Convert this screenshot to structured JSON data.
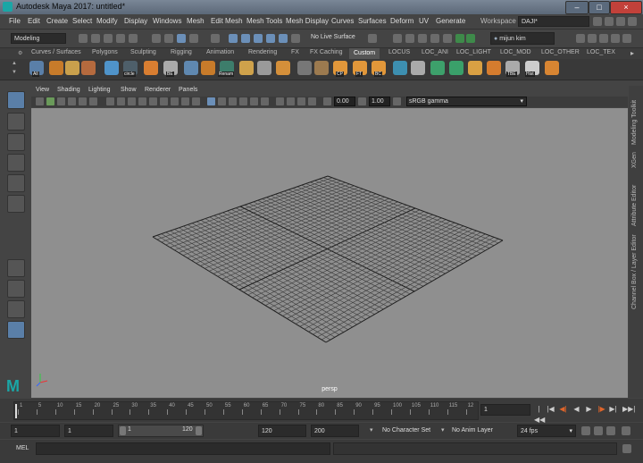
{
  "window": {
    "title": "Autodesk Maya 2017: untitled*",
    "minimize": "–",
    "maximize": "□",
    "close": "×"
  },
  "menubar": {
    "items": [
      "File",
      "Edit",
      "Create",
      "Select",
      "Modify",
      "Display",
      "Windows",
      "Mesh",
      "Edit Mesh",
      "Mesh Tools",
      "Mesh Display",
      "Curves",
      "Surfaces",
      "Deform",
      "UV",
      "Generate"
    ],
    "workspace_label": "Workspace :",
    "workspace_value": "DAJI*"
  },
  "statusline": {
    "mode": "Modeling",
    "live_surface": "No Live Surface",
    "user": "mijun kim"
  },
  "shelf": {
    "tabs": [
      "Curves / Surfaces",
      "Polygons",
      "Sculpting",
      "Rigging",
      "Animation",
      "Rendering",
      "FX",
      "FX Caching",
      "Custom",
      "LOCUS",
      "LOC_ANI",
      "LOC_LIGHT",
      "LOC_MOD",
      "LOC_OTHER",
      "LOC_TEX"
    ],
    "active_tab": "Custom",
    "icon_labels": {
      "all": "All",
      "circle": "circle",
      "be": "BE",
      "rename": "Renam",
      "cp": "CP",
      "ft": "FT",
      "bc": "BC",
      "tbe": "TBE",
      "hist": "Hist"
    }
  },
  "panel": {
    "menu": [
      "View",
      "Shading",
      "Lighting",
      "Show",
      "Renderer",
      "Panels"
    ],
    "exposure": "0.00",
    "gamma": "1.00",
    "colorspace": "sRGB gamma",
    "camera_label": "persp",
    "axis_y": "Y",
    "axis_z": "Z",
    "axis_x": "x"
  },
  "rightbar": {
    "tabs": [
      "Modeling Toolkit",
      "XGen",
      "Attribute Editor",
      "Channel Box / Layer Editor"
    ]
  },
  "timeslider": {
    "ticks": [
      "1",
      "5",
      "10",
      "15",
      "20",
      "25",
      "30",
      "35",
      "40",
      "45",
      "50",
      "55",
      "60",
      "65",
      "70",
      "75",
      "80",
      "85",
      "90",
      "95",
      "100",
      "105",
      "110",
      "115",
      "12"
    ],
    "current_frame": "1",
    "controls": [
      "|◀◀",
      "|◀",
      "◀|",
      "◀",
      "▶",
      "|▶",
      "▶|",
      "▶▶|"
    ]
  },
  "rangeslider": {
    "start": "1",
    "playback_start": "1",
    "range_start": "1",
    "range_end": "120",
    "playback_end": "120",
    "end": "200",
    "character_set": "No Character Set",
    "anim_layer": "No Anim Layer",
    "fps": "24 fps"
  },
  "cmdline": {
    "label": "MEL"
  },
  "colors": {
    "viewport": "#8f8f8f",
    "grid": "#3a3a3a",
    "accent": "#5a7fa8",
    "maya_logo": "#1aa6a6"
  }
}
